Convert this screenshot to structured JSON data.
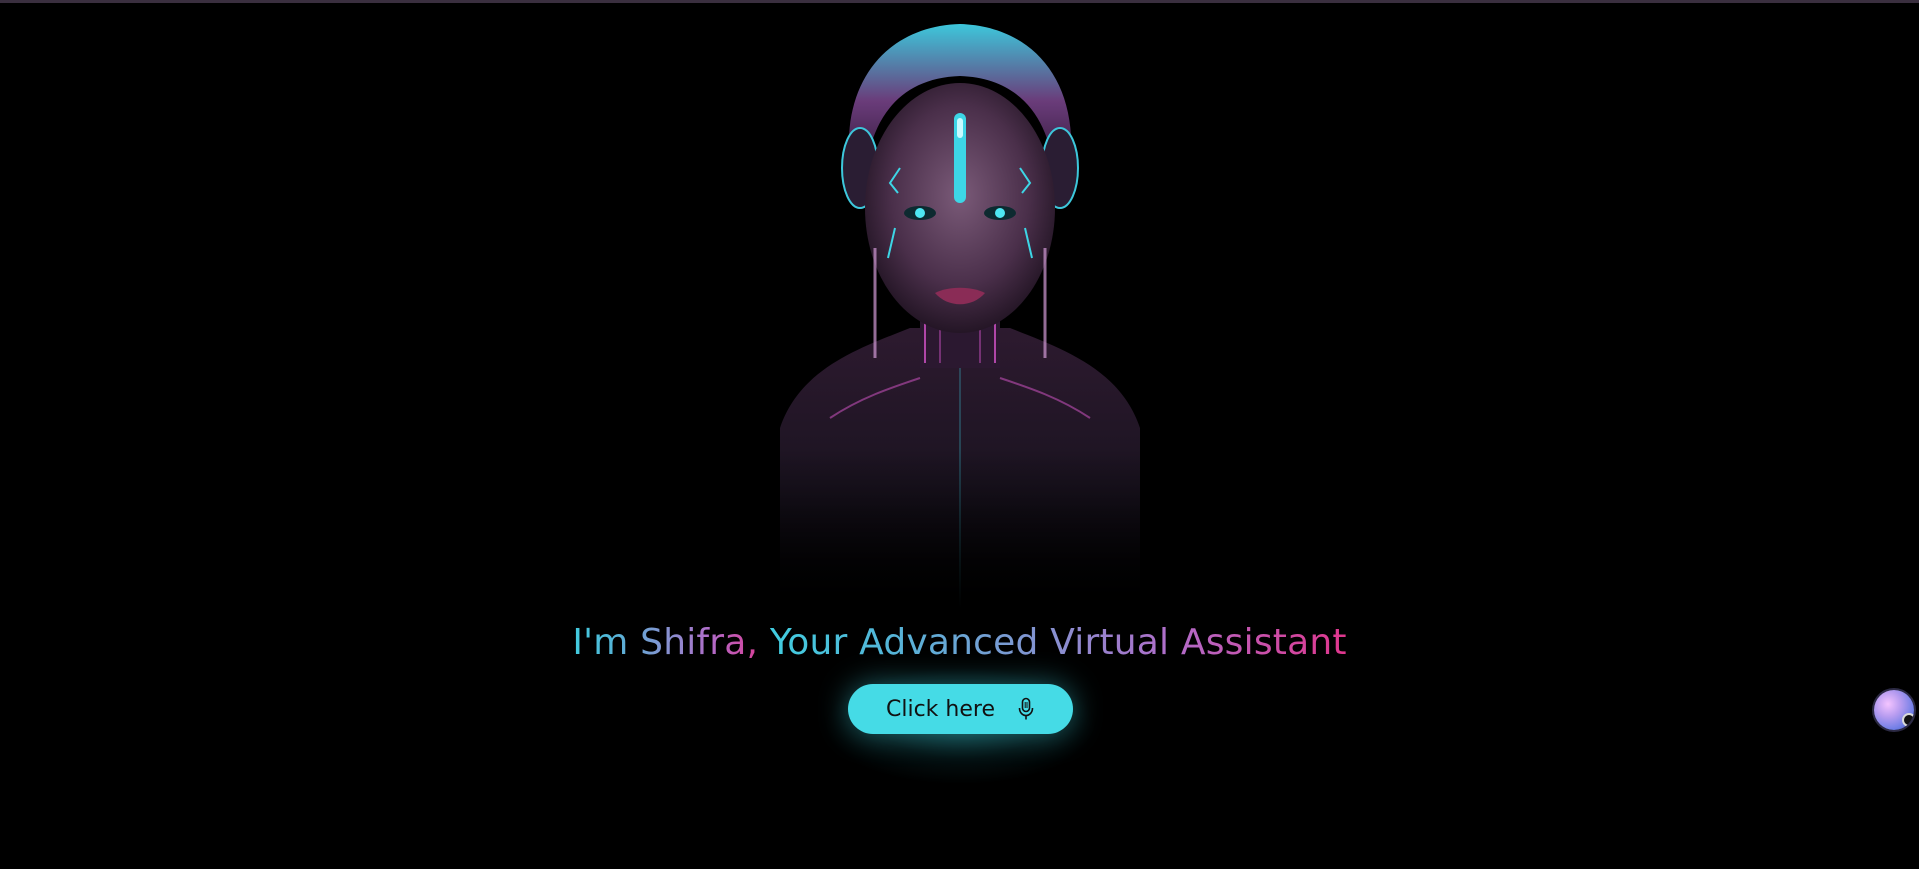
{
  "hero": {
    "title_part1": "I'm Shifra, ",
    "title_part2": "Your Advanced Virtual Assistant",
    "image_icon": "robot-woman-portrait"
  },
  "cta": {
    "label": "Click here",
    "icon": "microphone-icon"
  },
  "floating": {
    "icon": "assistant-avatar-icon"
  },
  "colors": {
    "background": "#000000",
    "accent_cyan": "#45dbe6",
    "accent_magenta": "#e0368d",
    "accent_violet": "#b16cc9"
  }
}
